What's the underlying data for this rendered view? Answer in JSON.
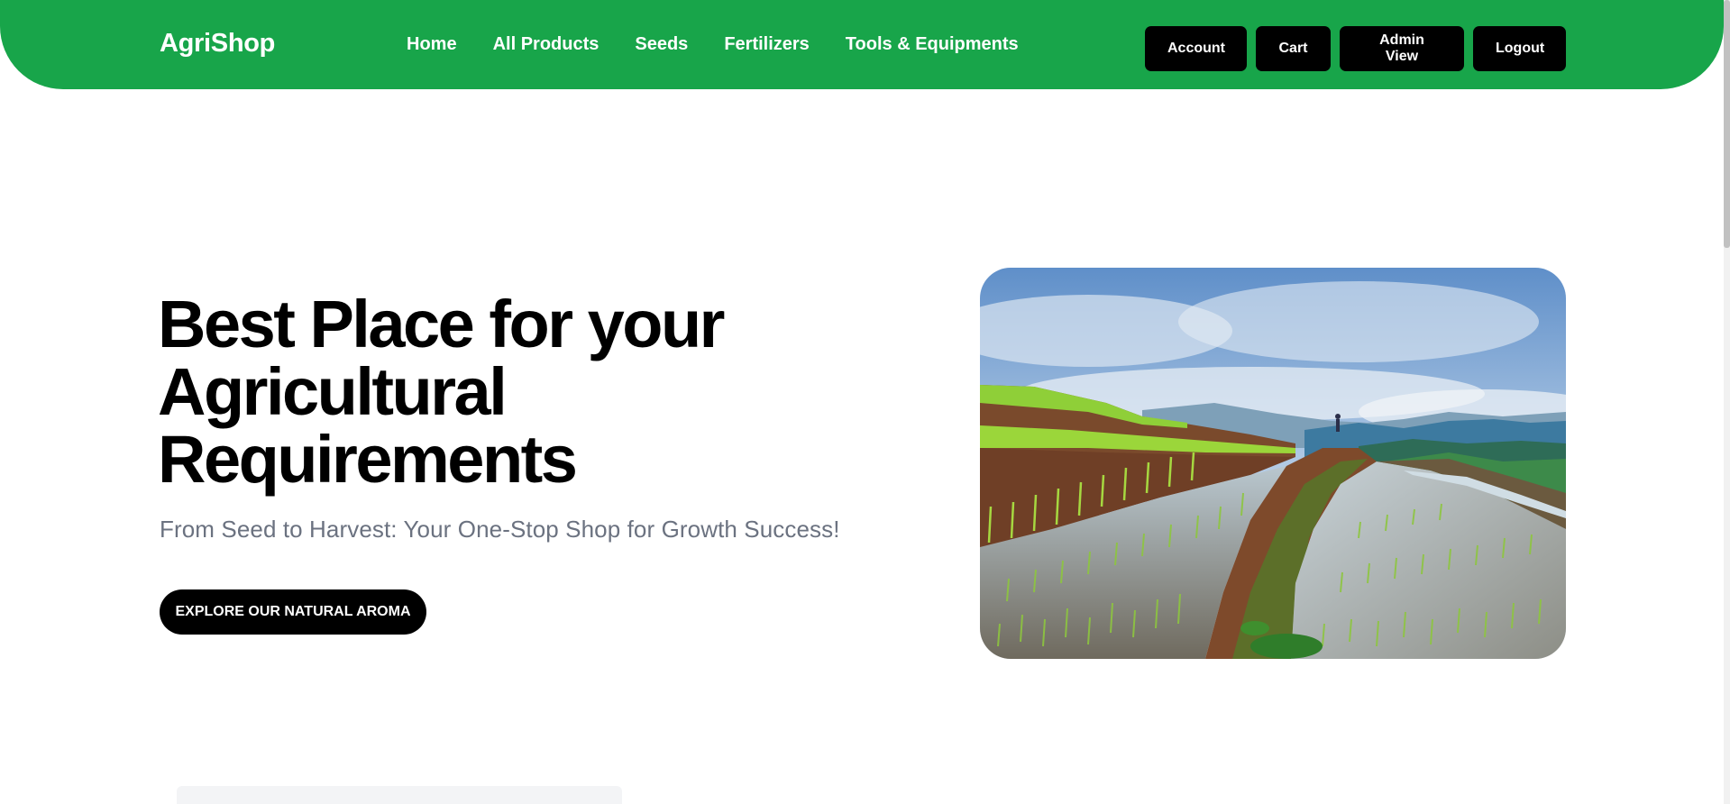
{
  "header": {
    "brand": "AgriShop",
    "nav": [
      {
        "label": "Home"
      },
      {
        "label": "All Products"
      },
      {
        "label": "Seeds"
      },
      {
        "label": "Fertilizers"
      },
      {
        "label": "Tools & Equipments"
      }
    ],
    "actions": {
      "account": "Account",
      "cart": "Cart",
      "admin": "Admin View",
      "logout": "Logout"
    }
  },
  "hero": {
    "title": "Best Place for your Agricultural Requirements",
    "subtitle": "From Seed to Harvest: Your One-Stop Shop for Growth Success!",
    "cta": "EXPLORE OUR NATURAL AROMA",
    "image": "rice-terrace-photo"
  },
  "colors": {
    "brand_green": "#18a54a",
    "button_black": "#000000",
    "subtitle_gray": "#6b7280"
  }
}
